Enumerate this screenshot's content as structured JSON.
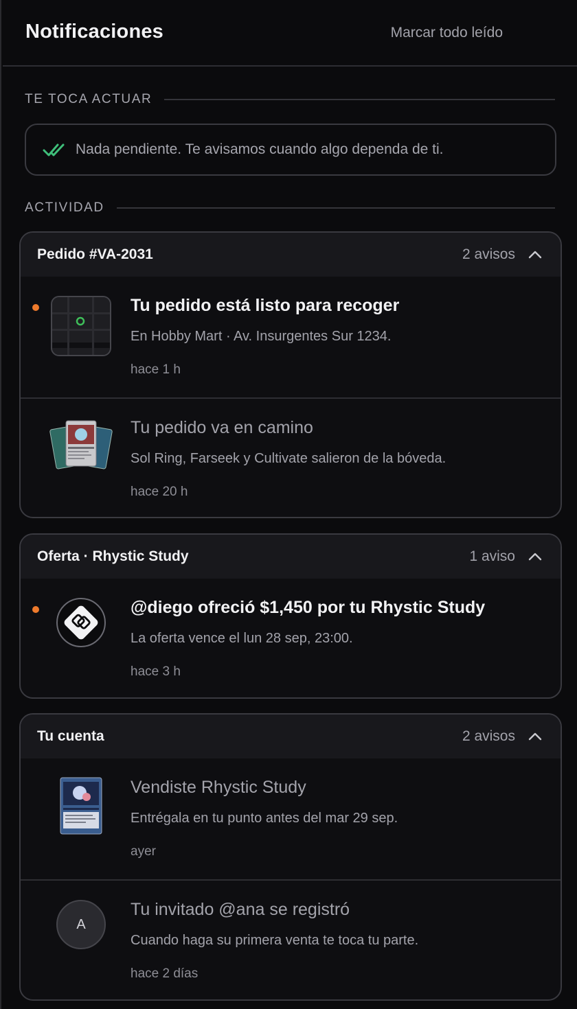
{
  "header": {
    "title": "Notificaciones",
    "mark_all": "Marcar todo leído"
  },
  "sections": {
    "action": "TE TOCA ACTUAR",
    "activity": "ACTIVIDAD"
  },
  "empty_state": {
    "text": "Nada pendiente. Te avisamos cuando algo dependa de ti.",
    "icon": "double-check-icon"
  },
  "colors": {
    "accent_dot": "#ee7a2c",
    "check_green": "#3fbf7a",
    "map_pin_green": "#3fbf5a"
  },
  "groups": [
    {
      "title": "Pedido #VA-2031",
      "count": "2 avisos",
      "items": [
        {
          "title": "Tu pedido está listo para recoger",
          "desc": "En Hobby Mart · Av. Insurgentes Sur 1234.",
          "time": "hace 1 h",
          "unread": true,
          "icon": "map-icon"
        },
        {
          "title": "Tu pedido va en camino",
          "desc": "Sol Ring, Farseek y Cultivate salieron de la bóveda.",
          "time": "hace 20 h",
          "unread": false,
          "icon": "card-stack-icon"
        }
      ]
    },
    {
      "title": "Oferta · Rhystic Study",
      "count": "1 aviso",
      "items": [
        {
          "title": "@diego ofreció $1,450 por tu Rhystic Study",
          "desc": "La oferta vence el lun 28 sep, 23:00.",
          "time": "hace 3 h",
          "unread": true,
          "icon": "offer-logo-icon"
        }
      ]
    },
    {
      "title": "Tu cuenta",
      "count": "2 avisos",
      "items": [
        {
          "title": "Vendiste Rhystic Study",
          "desc": "Entrégala en tu punto antes del mar 29 sep.",
          "time": "ayer",
          "unread": false,
          "icon": "card-icon"
        },
        {
          "title": "Tu invitado @ana se registró",
          "desc": "Cuando haga su primera venta te toca tu parte.",
          "time": "hace 2 días",
          "unread": false,
          "avatar_letter": "A"
        }
      ]
    }
  ]
}
